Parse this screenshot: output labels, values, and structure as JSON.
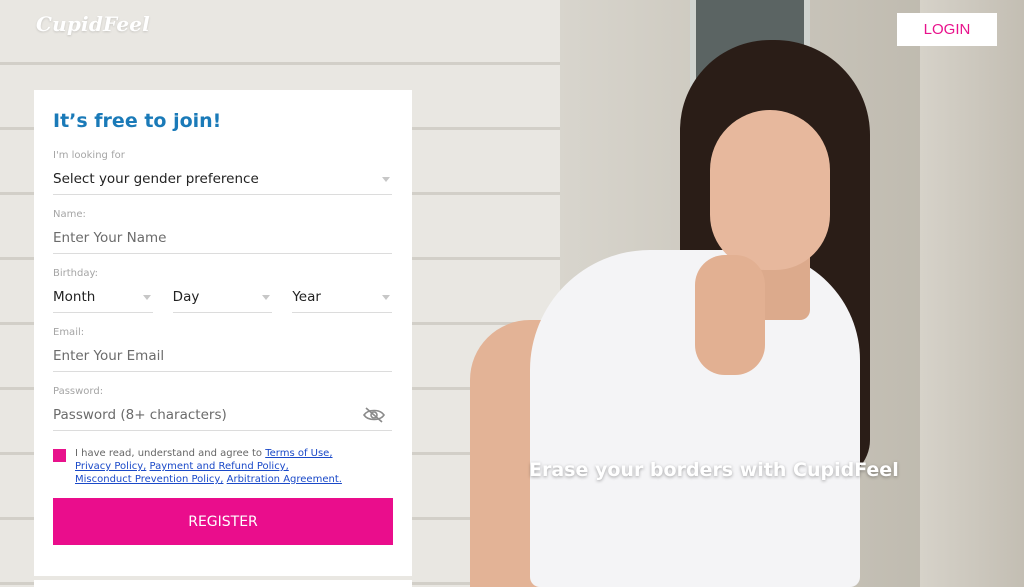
{
  "header": {
    "logo_text": "CupidFeel",
    "login_label": "LOGIN"
  },
  "hero": {
    "tagline": "Erase your borders with CupidFeel"
  },
  "form": {
    "title": "It’s free to join!",
    "looking_for": {
      "label": "I'm looking for",
      "value": "Select your gender preference"
    },
    "name": {
      "label": "Name:",
      "placeholder": "Enter Your Name"
    },
    "birthday": {
      "label": "Birthday:",
      "month": "Month",
      "day": "Day",
      "year": "Year"
    },
    "email": {
      "label": "Email:",
      "placeholder": "Enter Your Email"
    },
    "password": {
      "label": "Password:",
      "placeholder": "Password (8+ characters)"
    },
    "agreement": {
      "prefix": "I have read, understand and agree to ",
      "links": [
        "Terms of Use,",
        "Privacy Policy,",
        "Payment and Refund Policy,",
        "Misconduct Prevention Policy,",
        "Arbitration Agreement."
      ]
    },
    "register_label": "REGISTER"
  },
  "colors": {
    "accent": "#ea0d8c",
    "title_blue": "#1a7ab8",
    "link_blue": "#1a49c8"
  },
  "icons": [
    "eye-slash-icon",
    "chevron-down-icon"
  ]
}
